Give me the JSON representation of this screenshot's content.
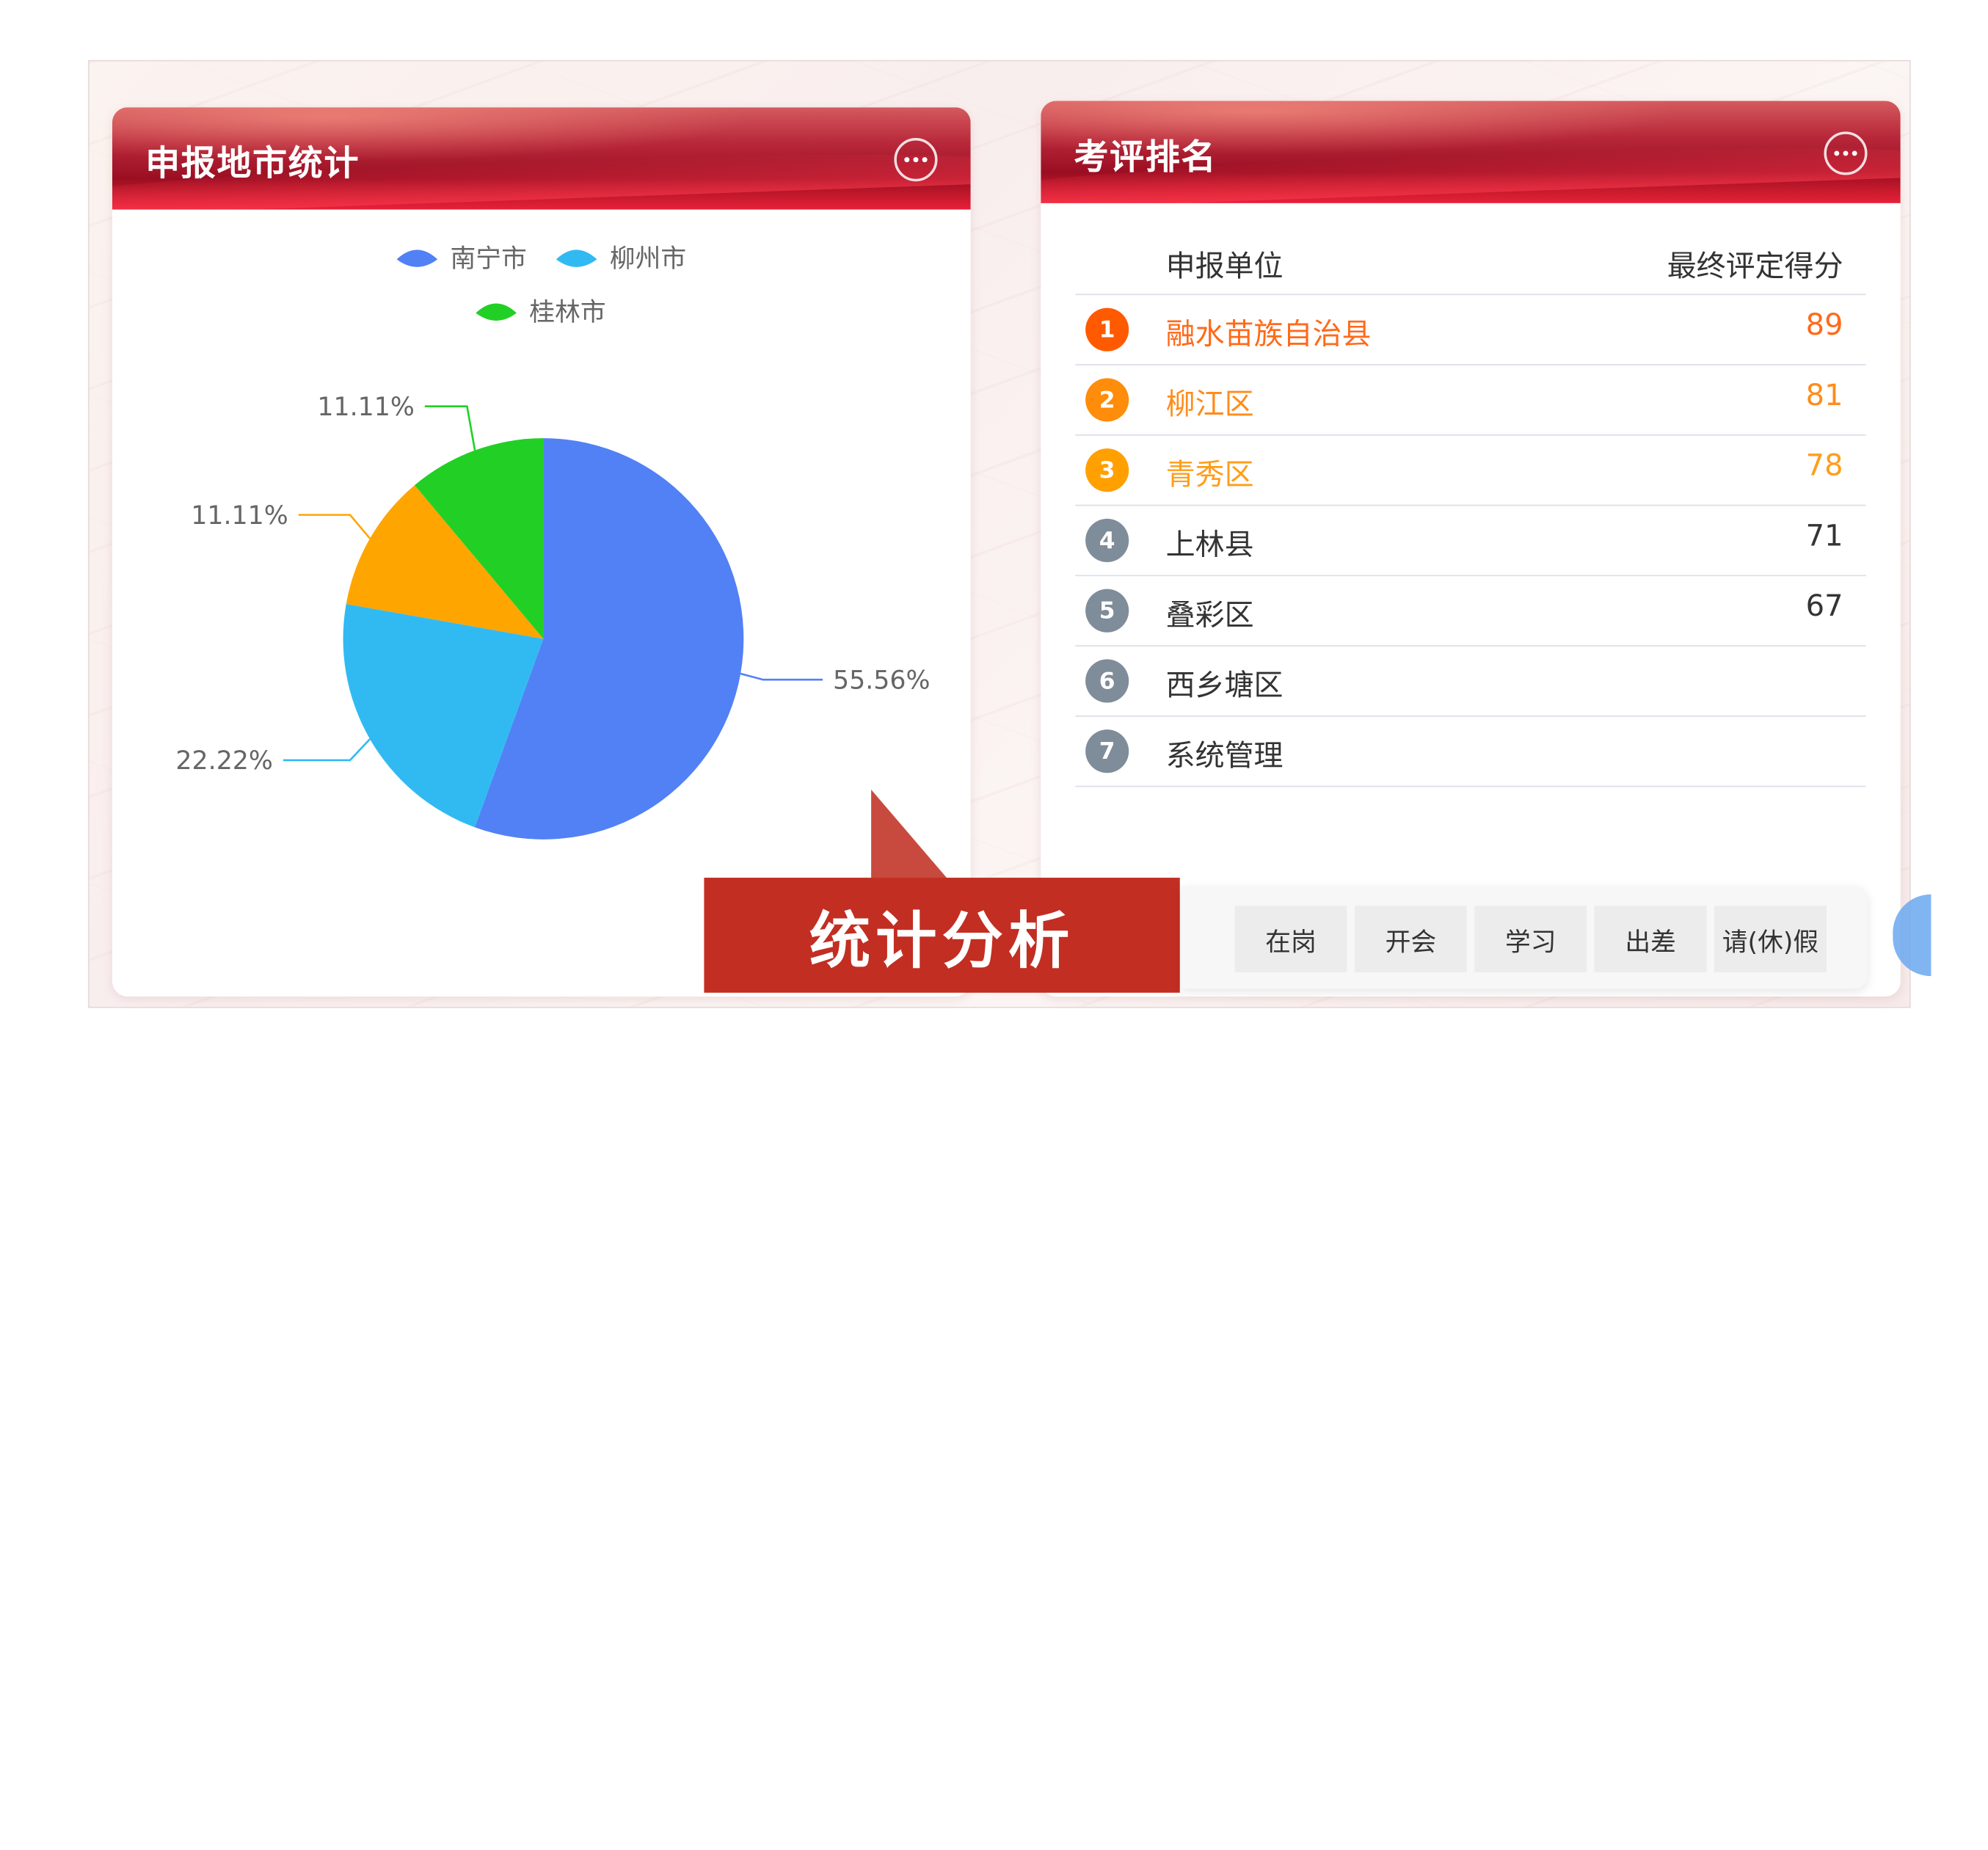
{
  "left_panel": {
    "title": "申报地市统计"
  },
  "right_panel": {
    "title": "考评排名",
    "col_unit": "申报单位",
    "col_score": "最终评定得分",
    "rows": [
      {
        "rank": "1",
        "name": "融水苗族自治县",
        "score": "89",
        "color": "#ff5a00",
        "text_color": "#ff6a1a"
      },
      {
        "rank": "2",
        "name": "柳江区",
        "score": "81",
        "color": "#ff8c0a",
        "text_color": "#ff8c1a"
      },
      {
        "rank": "3",
        "name": "青秀区",
        "score": "78",
        "color": "#ffa000",
        "text_color": "#ff9d1a"
      },
      {
        "rank": "4",
        "name": "上林县",
        "score": "71",
        "color": "#7f8c99",
        "text_color": "#333333"
      },
      {
        "rank": "5",
        "name": "叠彩区",
        "score": "67",
        "color": "#7f8c99",
        "text_color": "#333333"
      },
      {
        "rank": "6",
        "name": "西乡塘区",
        "score": "",
        "color": "#7f8c99",
        "text_color": "#333333"
      },
      {
        "rank": "7",
        "name": "系统管理",
        "score": "",
        "color": "#7f8c99",
        "text_color": "#333333"
      }
    ]
  },
  "chart_data": {
    "type": "pie",
    "legend": [
      "南宁市",
      "柳州市",
      "桂林市"
    ],
    "slices": [
      {
        "name": "南宁市",
        "value": 55.56,
        "label": "55.56%",
        "color": "#5181f5"
      },
      {
        "name": "柳州市",
        "value": 22.22,
        "label": "22.22%",
        "color": "#31baf2"
      },
      {
        "name": "",
        "value": 11.11,
        "label": "11.11%",
        "color": "#ffa500"
      },
      {
        "name": "桂林市",
        "value": 11.11,
        "label": "11.11%",
        "color": "#22d025"
      }
    ],
    "legend_placement": "top-center"
  },
  "banner": {
    "text": "统计分析"
  },
  "status_bar": {
    "buttons": [
      "在岗",
      "开会",
      "学习",
      "出差",
      "请(休)假"
    ]
  }
}
